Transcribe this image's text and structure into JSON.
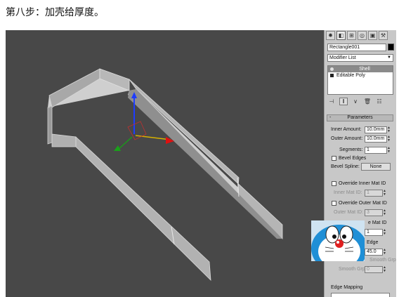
{
  "caption": "第八步：加壳给厚度。",
  "command_panel": {
    "tabs": [
      {
        "icon": "create-icon",
        "glyph": "✹"
      },
      {
        "icon": "modify-icon",
        "glyph": "◧"
      },
      {
        "icon": "hierarchy-icon",
        "glyph": "⊞"
      },
      {
        "icon": "motion-icon",
        "glyph": "◎"
      },
      {
        "icon": "display-icon",
        "glyph": "▣"
      },
      {
        "icon": "utilities-icon",
        "glyph": "⚒"
      }
    ],
    "object_name": "Rectangle001",
    "object_color": "#000000",
    "modifier_list_label": "Modifier List",
    "stack": [
      {
        "label": "Shell",
        "selected": true
      },
      {
        "label": "Editable Poly",
        "selected": false
      }
    ],
    "stack_tools": [
      {
        "icon": "pin-stack-icon",
        "glyph": "⊣"
      },
      {
        "icon": "show-end-result-icon",
        "glyph": "‖"
      },
      {
        "icon": "make-unique-icon",
        "glyph": "∨"
      },
      {
        "icon": "remove-modifier-icon",
        "glyph": "🗑"
      },
      {
        "icon": "configure-modifier-sets-icon",
        "glyph": "☷"
      }
    ],
    "rollout_title": "Parameters",
    "rollout_toggle": "-",
    "inner_amount_label": "Inner Amount:",
    "inner_amount_value": "10.0mm",
    "outer_amount_label": "Outer Amount:",
    "outer_amount_value": "10.0mm",
    "segments_label": "Segments:",
    "segments_value": "1",
    "bevel_edges_label": "Bevel Edges",
    "bevel_spline_label": "Bevel Spline:",
    "bevel_spline_button": "None",
    "override_inner_label": "Override Inner Mat ID",
    "inner_mat_label": "Inner Mat ID:",
    "inner_mat_value": "1",
    "override_outer_label": "Override Outer Mat ID",
    "outer_mat_label": "Outer Mat ID:",
    "outer_mat_value": "3",
    "override_edge_partial": "e Mat ID",
    "edge_mat_value": "1",
    "straighten_partial": "Edge",
    "angle_value": "45.0",
    "smooth_grp_partial": "Smooth Grp",
    "smooth_grp_label": "Smooth Grp:",
    "smooth_grp_value": "0",
    "edge_mapping_label": "Edge Mapping"
  }
}
